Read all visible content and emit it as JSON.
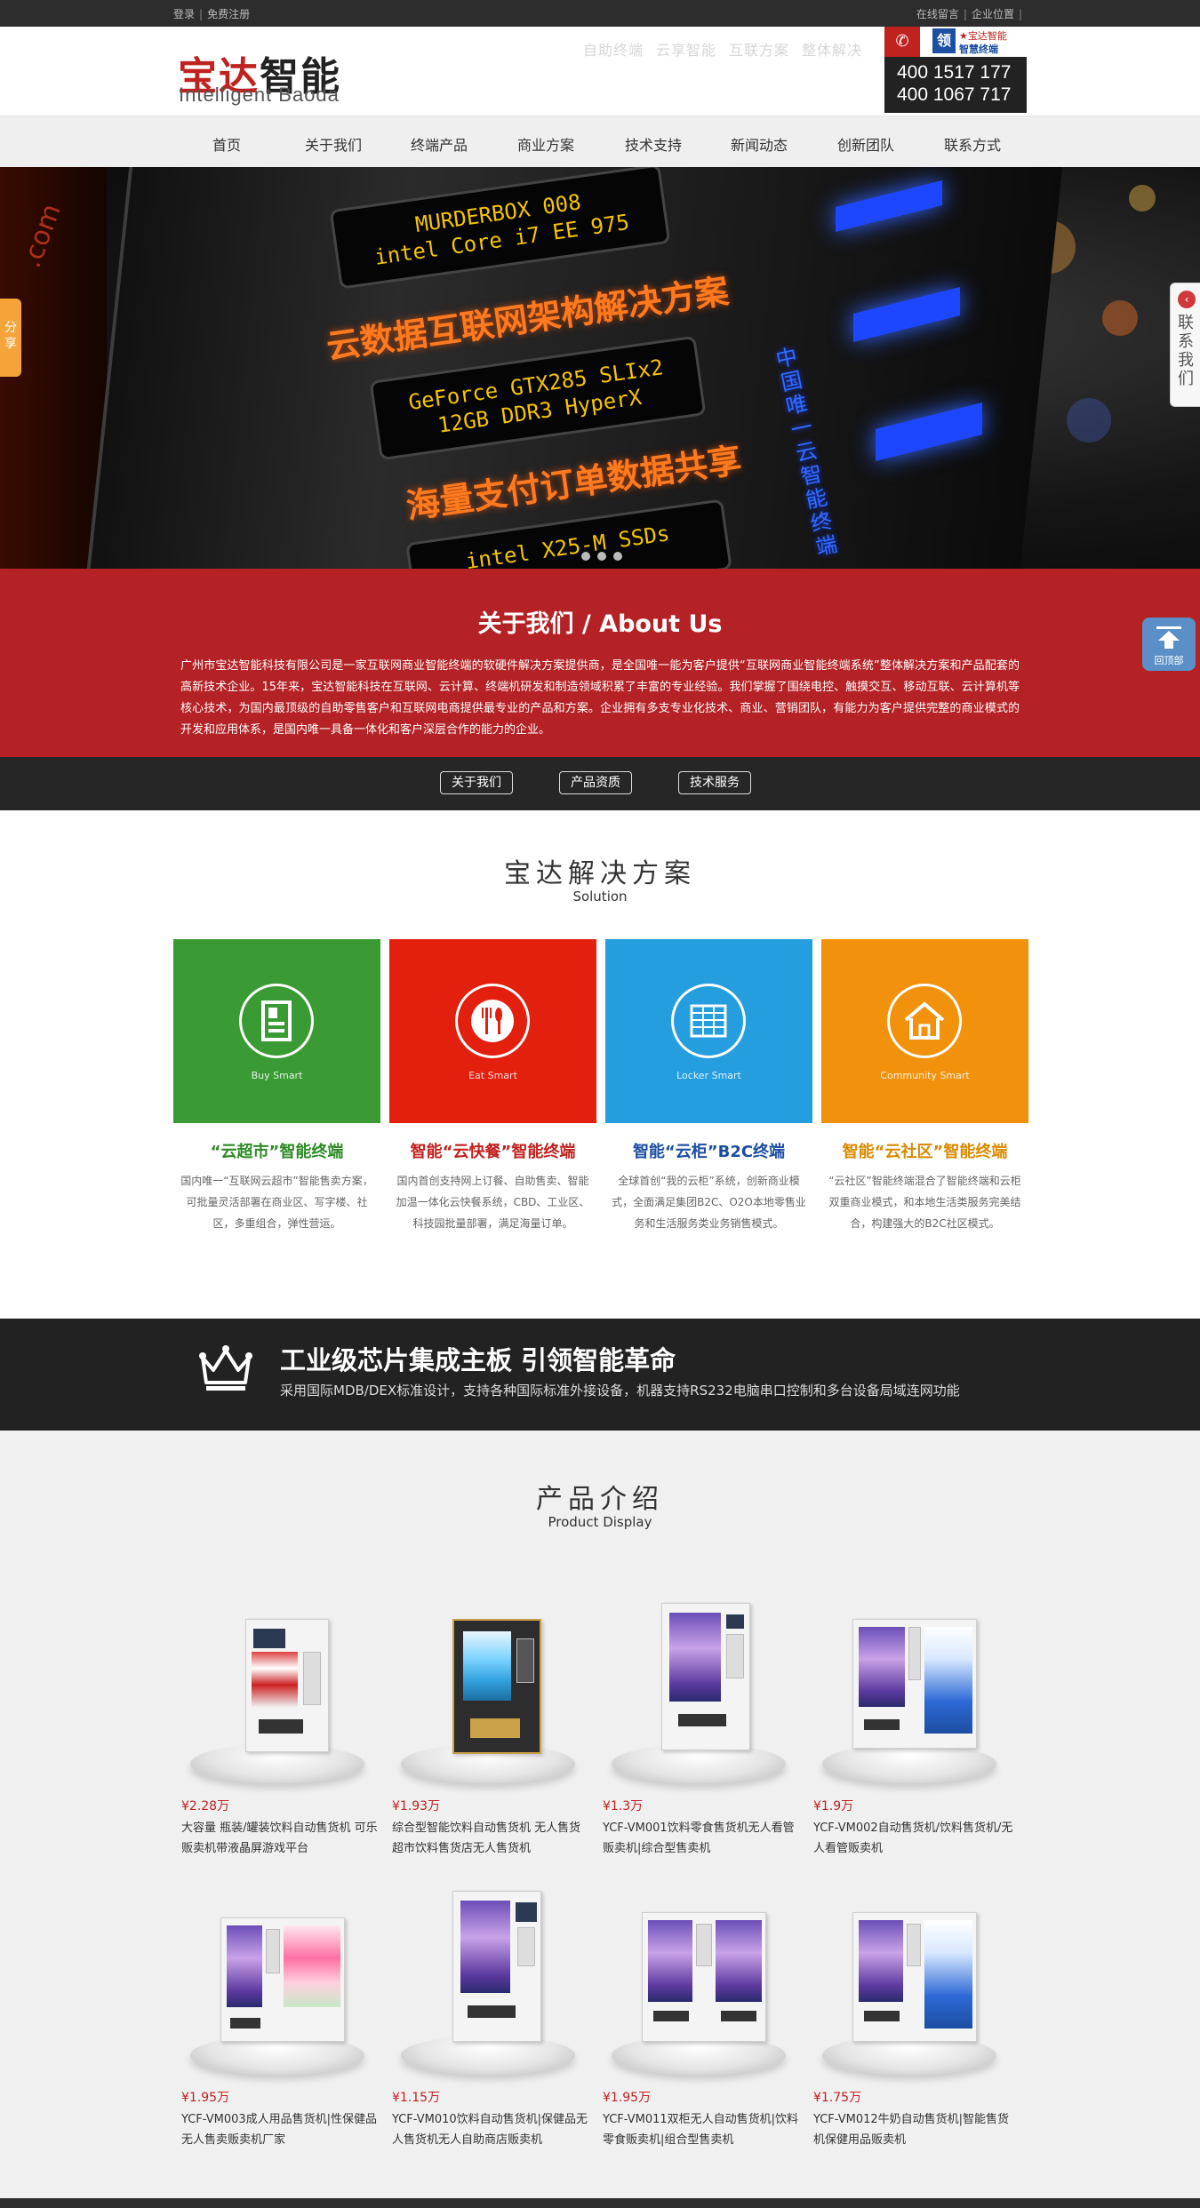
{
  "topbar": {
    "login": "登录",
    "register": "免费注册",
    "message": "在线留言",
    "location": "企业位置"
  },
  "header": {
    "logo_cn_red": "宝达",
    "logo_cn_black": "智能",
    "logo_en": "Intelligent Baoda",
    "slogans": [
      "自助终端",
      "云享智能",
      "互联方案",
      "整体解决"
    ],
    "brand_char": "领",
    "brand_line1": "★宝达智能",
    "brand_line2": "智慧终端",
    "phone1": "400 1517 177",
    "phone2": "400 1067 717"
  },
  "nav": {
    "items": [
      {
        "label": "首页"
      },
      {
        "label": "关于我们"
      },
      {
        "label": "终端产品"
      },
      {
        "label": "商业方案"
      },
      {
        "label": "技术支持"
      },
      {
        "label": "新闻动态"
      },
      {
        "label": "创新团队"
      },
      {
        "label": "联系方式"
      }
    ]
  },
  "banner": {
    "lcd1": [
      "MURDERBOX  008",
      "intel Core i7 EE 975"
    ],
    "slogan1": "云数据互联网架构解决方案",
    "lcd2": [
      "GeForce GTX285 SLIx2",
      "12GB DDR3 HyperX"
    ],
    "slogan2": "海量支付订单数据共享",
    "lcd3": "intel X25-M SSDs",
    "vertical": "中国唯一云智能终端",
    "side_text": ".com"
  },
  "about": {
    "title": "关于我们 / About Us",
    "text": "广州市宝达智能科技有限公司是一家互联网商业智能终端的软硬件解决方案提供商，是全国唯一能为客户提供“互联网商业智能终端系统”整体解决方案和产品配套的高新技术企业。15年来，宝达智能科技在互联网、云计算、终端机研发和制造领域积累了丰富的专业经验。我们掌握了围绕电控、触摸交互、移动互联、云计算机等核心技术，为国内最顶级的自助零售客户和互联网电商提供最专业的产品和方案。企业拥有多支专业化技术、商业、营销团队，有能力为客户提供完整的商业模式的开发和应用体系，是国内唯一具备一体化和客户深层合作的能力的企业。",
    "buttons": [
      "关于我们",
      "产品资质",
      "技术服务"
    ]
  },
  "solutions": {
    "title": "宝达解决方案",
    "subtitle": "Solution",
    "items": [
      {
        "en": "Buy Smart",
        "name": "“云超市”智能终端",
        "desc": "国内唯一“互联网云超市”智能售卖方案，可批量灵活部署在商业区、写字楼、社区，多重组合，弹性营运。",
        "color": "#3a9b34",
        "name_color": "#2d8a26",
        "icon": "store-icon"
      },
      {
        "en": "Eat Smart",
        "name": "智能“云快餐”智能终端",
        "desc": "国内首创支持网上订餐、自助售卖、智能加温一体化云快餐系统，CBD、工业区、科技园批量部署，满足海量订单。",
        "color": "#e31f0e",
        "name_color": "#c0221f",
        "icon": "cutlery-icon"
      },
      {
        "en": "Locker Smart",
        "name": "智能“云柜”B2C终端",
        "desc": "全球首创“我的云柜”系统，创新商业模式，全面满足集团B2C、O2O本地零售业务和生活服务类业务销售模式。",
        "color": "#259ee0",
        "name_color": "#1c4ea2",
        "icon": "locker-icon"
      },
      {
        "en": "Community Smart",
        "name": "智能“云社区”智能终端",
        "desc": "“云社区”智能终端混合了智能终端和云柜双重商业模式，和本地生活类服务完美结合，构建强大的B2C社区模式。",
        "color": "#f2920c",
        "name_color": "#d98a00",
        "icon": "home-icon"
      }
    ]
  },
  "strip": {
    "title": "工业级芯片集成主板 引领智能革命",
    "text": "采用国际MDB/DEX标准设计，支持各种国际标准外接设备，机器支持RS232电脑串口控制和多台设备局域连网功能"
  },
  "products": {
    "title": "产品介绍",
    "subtitle": "Product Display",
    "items": [
      {
        "price": "¥2.28万",
        "desc": "大容量 瓶装/罐装饮料自动售货机 可乐贩卖机带液晶屏游戏平台"
      },
      {
        "price": "¥1.93万",
        "desc": "综合型智能饮料自动售货机 无人售货超市饮料售货店无人售货机"
      },
      {
        "price": "¥1.3万",
        "desc": "YCF-VM001饮料零食售货机无人看管贩卖机|综合型售卖机"
      },
      {
        "price": "¥1.9万",
        "desc": "YCF-VM002自动售货机/饮料售货机/无人看管贩卖机"
      },
      {
        "price": "¥1.95万",
        "desc": "YCF-VM003成人用品售货机|性保健品无人售卖贩卖机厂家"
      },
      {
        "price": "¥1.15万",
        "desc": "YCF-VM010饮料自动售货机|保健品无人售货机无人自助商店贩卖机"
      },
      {
        "price": "¥1.95万",
        "desc": "YCF-VM011双柜无人自动售货机|饮料零食贩卖机|组合型售卖机"
      },
      {
        "price": "¥1.75万",
        "desc": "YCF-VM012牛奶自动售货机|智能售货机保健用品贩卖机"
      }
    ]
  },
  "widgets": {
    "share": "分享",
    "contact": "联系我们",
    "totop": "回顶部"
  }
}
